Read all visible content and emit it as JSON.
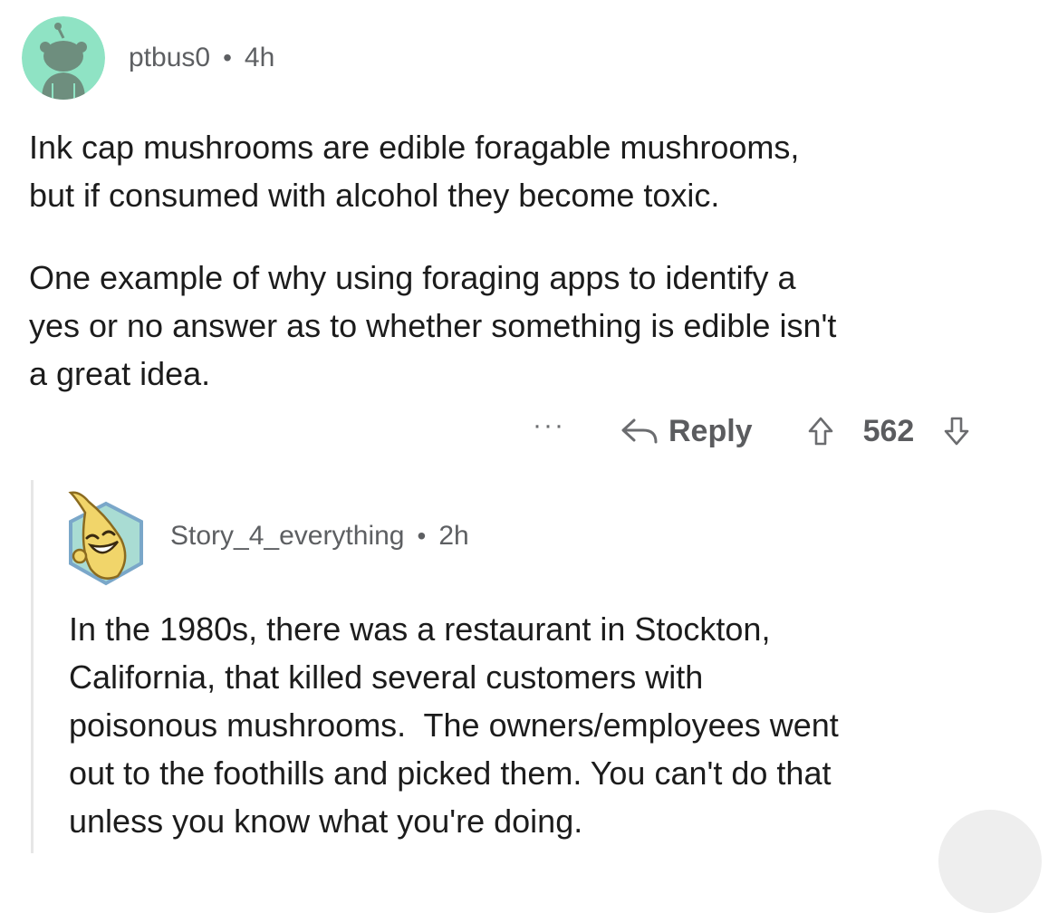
{
  "comment": {
    "username": "ptbus0",
    "separator": "•",
    "age": "4h",
    "paragraphs": [
      "Ink cap mushrooms are edible foragable mushrooms,\nbut if consumed with alcohol they become toxic.",
      "One example of why using foraging apps to identify a\nyes or no answer as to whether something is edible isn't\na great idea."
    ],
    "actions": {
      "more": "···",
      "reply_label": "Reply",
      "score": "562"
    },
    "avatar_colors": {
      "background": "#8fe3c4",
      "figure": "#6e8e7e"
    }
  },
  "reply": {
    "username": "Story_4_everything",
    "separator": "•",
    "age": "2h",
    "paragraphs": [
      "In the 1980s, there was a restaurant in Stockton,\nCalifornia, that killed several customers with\npoisonous mushrooms.  The owners/employees went\nout to the foothills and picked them. You can't do that\nunless you know what you're doing."
    ],
    "avatar_colors": {
      "hex_border": "#7aa7c9",
      "hex_fill": "#a9dcd3",
      "banana": "#f1d56a"
    }
  },
  "icons": {
    "reply": "reply-arrow-icon",
    "upvote": "upvote-arrow-icon",
    "downvote": "downvote-arrow-icon"
  }
}
